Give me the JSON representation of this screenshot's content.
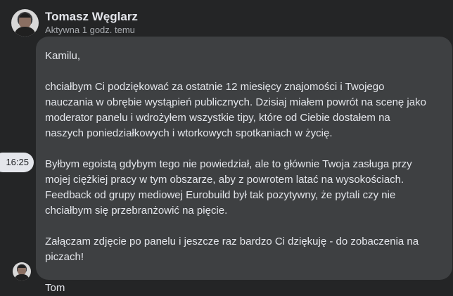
{
  "header": {
    "name": "Tomasz Węglarz",
    "status": "Aktywna 1 godz. temu"
  },
  "message": {
    "timestamp": "16:25",
    "paragraphs": [
      "Kamilu,",
      "chciałbym Ci podziękować za ostatnie 12 miesięcy znajomości i Twojego\nnauczania w obrębie wystąpień publicznych. Dzisiaj miałem powrót na scenę jako\nmoderator panelu i wdrożyłem wszystkie tipy, które od Ciebie dostałem na\nnaszych poniedziałkowych i wtorkowych spotkaniach w życię.",
      "Byłbym egoistą gdybym tego nie powiedział, ale to głównie Twoja zasługa przy\nmojej ciężkiej pracy w tym obszarze, aby z powrotem latać na wysokościach.\nFeedback od grupy mediowej Eurobuild był tak pozytywny, że pytali czy nie\nchciałbym się przebranżowić na pięcie.",
      "Załączam zdjęcie po panelu i jeszcze raz bardzo Ci dziękuję - do zobaczenia na\npiczach!",
      "Tom"
    ]
  },
  "icons": {
    "header_avatar": "user-avatar",
    "message_avatar": "user-avatar"
  }
}
